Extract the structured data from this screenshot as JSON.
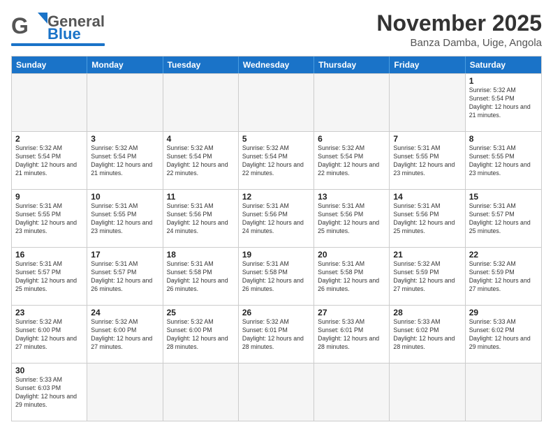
{
  "header": {
    "logo_general": "General",
    "logo_blue": "Blue",
    "month_title": "November 2025",
    "location": "Banza Damba, Uige, Angola"
  },
  "days_of_week": [
    "Sunday",
    "Monday",
    "Tuesday",
    "Wednesday",
    "Thursday",
    "Friday",
    "Saturday"
  ],
  "weeks": [
    [
      {
        "day": "",
        "info": ""
      },
      {
        "day": "",
        "info": ""
      },
      {
        "day": "",
        "info": ""
      },
      {
        "day": "",
        "info": ""
      },
      {
        "day": "",
        "info": ""
      },
      {
        "day": "",
        "info": ""
      },
      {
        "day": "1",
        "info": "Sunrise: 5:32 AM\nSunset: 5:54 PM\nDaylight: 12 hours and 21 minutes."
      }
    ],
    [
      {
        "day": "2",
        "info": "Sunrise: 5:32 AM\nSunset: 5:54 PM\nDaylight: 12 hours and 21 minutes."
      },
      {
        "day": "3",
        "info": "Sunrise: 5:32 AM\nSunset: 5:54 PM\nDaylight: 12 hours and 21 minutes."
      },
      {
        "day": "4",
        "info": "Sunrise: 5:32 AM\nSunset: 5:54 PM\nDaylight: 12 hours and 22 minutes."
      },
      {
        "day": "5",
        "info": "Sunrise: 5:32 AM\nSunset: 5:54 PM\nDaylight: 12 hours and 22 minutes."
      },
      {
        "day": "6",
        "info": "Sunrise: 5:32 AM\nSunset: 5:54 PM\nDaylight: 12 hours and 22 minutes."
      },
      {
        "day": "7",
        "info": "Sunrise: 5:31 AM\nSunset: 5:55 PM\nDaylight: 12 hours and 23 minutes."
      },
      {
        "day": "8",
        "info": "Sunrise: 5:31 AM\nSunset: 5:55 PM\nDaylight: 12 hours and 23 minutes."
      }
    ],
    [
      {
        "day": "9",
        "info": "Sunrise: 5:31 AM\nSunset: 5:55 PM\nDaylight: 12 hours and 23 minutes."
      },
      {
        "day": "10",
        "info": "Sunrise: 5:31 AM\nSunset: 5:55 PM\nDaylight: 12 hours and 23 minutes."
      },
      {
        "day": "11",
        "info": "Sunrise: 5:31 AM\nSunset: 5:56 PM\nDaylight: 12 hours and 24 minutes."
      },
      {
        "day": "12",
        "info": "Sunrise: 5:31 AM\nSunset: 5:56 PM\nDaylight: 12 hours and 24 minutes."
      },
      {
        "day": "13",
        "info": "Sunrise: 5:31 AM\nSunset: 5:56 PM\nDaylight: 12 hours and 25 minutes."
      },
      {
        "day": "14",
        "info": "Sunrise: 5:31 AM\nSunset: 5:56 PM\nDaylight: 12 hours and 25 minutes."
      },
      {
        "day": "15",
        "info": "Sunrise: 5:31 AM\nSunset: 5:57 PM\nDaylight: 12 hours and 25 minutes."
      }
    ],
    [
      {
        "day": "16",
        "info": "Sunrise: 5:31 AM\nSunset: 5:57 PM\nDaylight: 12 hours and 25 minutes."
      },
      {
        "day": "17",
        "info": "Sunrise: 5:31 AM\nSunset: 5:57 PM\nDaylight: 12 hours and 26 minutes."
      },
      {
        "day": "18",
        "info": "Sunrise: 5:31 AM\nSunset: 5:58 PM\nDaylight: 12 hours and 26 minutes."
      },
      {
        "day": "19",
        "info": "Sunrise: 5:31 AM\nSunset: 5:58 PM\nDaylight: 12 hours and 26 minutes."
      },
      {
        "day": "20",
        "info": "Sunrise: 5:31 AM\nSunset: 5:58 PM\nDaylight: 12 hours and 26 minutes."
      },
      {
        "day": "21",
        "info": "Sunrise: 5:32 AM\nSunset: 5:59 PM\nDaylight: 12 hours and 27 minutes."
      },
      {
        "day": "22",
        "info": "Sunrise: 5:32 AM\nSunset: 5:59 PM\nDaylight: 12 hours and 27 minutes."
      }
    ],
    [
      {
        "day": "23",
        "info": "Sunrise: 5:32 AM\nSunset: 6:00 PM\nDaylight: 12 hours and 27 minutes."
      },
      {
        "day": "24",
        "info": "Sunrise: 5:32 AM\nSunset: 6:00 PM\nDaylight: 12 hours and 27 minutes."
      },
      {
        "day": "25",
        "info": "Sunrise: 5:32 AM\nSunset: 6:00 PM\nDaylight: 12 hours and 28 minutes."
      },
      {
        "day": "26",
        "info": "Sunrise: 5:32 AM\nSunset: 6:01 PM\nDaylight: 12 hours and 28 minutes."
      },
      {
        "day": "27",
        "info": "Sunrise: 5:33 AM\nSunset: 6:01 PM\nDaylight: 12 hours and 28 minutes."
      },
      {
        "day": "28",
        "info": "Sunrise: 5:33 AM\nSunset: 6:02 PM\nDaylight: 12 hours and 28 minutes."
      },
      {
        "day": "29",
        "info": "Sunrise: 5:33 AM\nSunset: 6:02 PM\nDaylight: 12 hours and 29 minutes."
      }
    ],
    [
      {
        "day": "30",
        "info": "Sunrise: 5:33 AM\nSunset: 6:03 PM\nDaylight: 12 hours and 29 minutes."
      },
      {
        "day": "",
        "info": ""
      },
      {
        "day": "",
        "info": ""
      },
      {
        "day": "",
        "info": ""
      },
      {
        "day": "",
        "info": ""
      },
      {
        "day": "",
        "info": ""
      },
      {
        "day": "",
        "info": ""
      }
    ]
  ]
}
